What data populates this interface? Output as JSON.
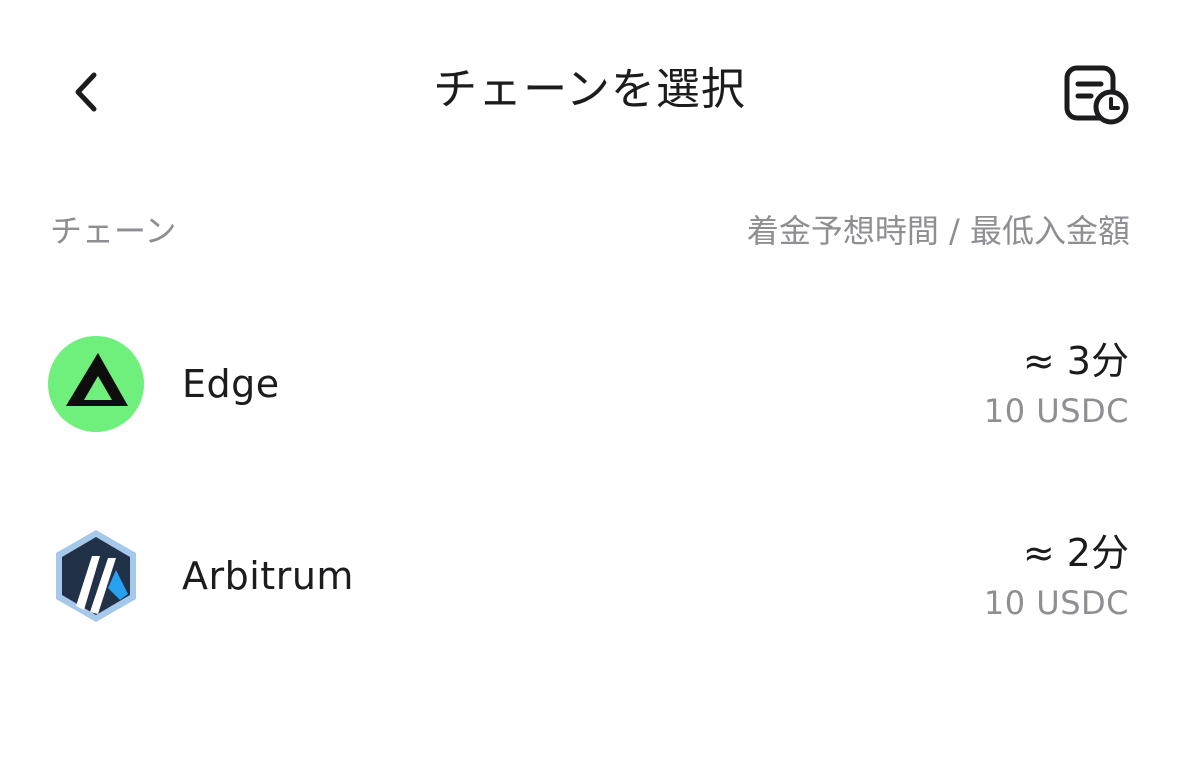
{
  "header": {
    "title": "チェーンを選択",
    "back_icon": "chevron-left-icon",
    "history_icon": "document-clock-icon"
  },
  "columns": {
    "left": "チェーン",
    "right": "着金予想時間 / 最低入金額"
  },
  "chains": [
    {
      "name": "Edge",
      "time": "≈ 3分",
      "min_deposit": "10 USDC",
      "logo": "edge-logo-icon",
      "logo_color": "#6ff07c"
    },
    {
      "name": "Arbitrum",
      "time": "≈ 2分",
      "min_deposit": "10 USDC",
      "logo": "arbitrum-logo-icon",
      "logo_color": "#213147"
    }
  ]
}
